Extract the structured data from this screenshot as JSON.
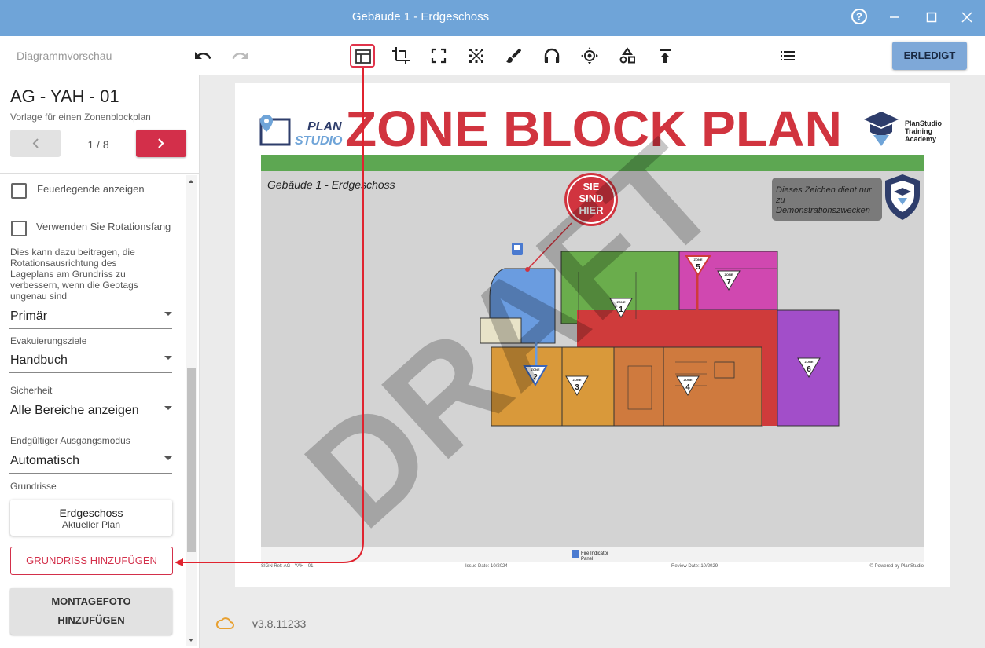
{
  "window": {
    "title": "Gebäude 1 - Erdgeschoss"
  },
  "toolbar": {
    "preview_label": "Diagrammvorschau",
    "done_label": "ERLEDIGT"
  },
  "sidebar": {
    "plan_title": "AG - YAH - 01",
    "plan_subtitle": "Vorlage für einen Zonenblockplan",
    "pager": "1 / 8",
    "fire_legend_label": "Feuerlegende anzeigen",
    "rotation_label": "Verwenden Sie Rotationsfang",
    "rotation_help": "Dies kann dazu beitragen, die Rotationsausrichtung des Lageplans am Grundriss zu verbessern, wenn die Geotags ungenau sind",
    "primary_value": "Primär",
    "evac_label": "Evakuierungsziele",
    "evac_value": "Handbuch",
    "security_label": "Sicherheit",
    "security_value": "Alle Bereiche anzeigen",
    "exit_label": "Endgültiger Ausgangsmodus",
    "exit_value": "Automatisch",
    "floorplans_label": "Grundrisse",
    "floor_name": "Erdgeschoss",
    "floor_current": "Aktueller Plan",
    "add_floorplan": "GRUNDRISS HINZUFÜGEN",
    "add_photo_line1": "MONTAGEFOTO",
    "add_photo_line2": "HINZUFÜGEN"
  },
  "main": {
    "version": "v3.8.11233"
  },
  "sheet": {
    "logo_plan": "PLAN",
    "logo_studio": "STUDIO",
    "title": "ZONE BLOCK PLAN",
    "academy": [
      "PlanStudio",
      "Training",
      "Academy"
    ],
    "building": "Gebäude 1 - Erdgeschoss",
    "demo_note": "Dieses Zeichen dient nur zu Demonstrationszwecken",
    "you_are_here": [
      "SIE",
      "SIND",
      "HIER"
    ],
    "watermark": "DRAFT",
    "fire_panel": [
      "Fire Indicator",
      "Panel"
    ],
    "footer_ref": "SIGN Ref: AG - YAH - 01",
    "footer_issue": "Issue Date: 10/2024",
    "footer_review": "Review Date: 10/2029",
    "footer_powered": "© Powered by PlanStudio",
    "zone_word": "ZONE",
    "zones": [
      "1",
      "2",
      "3",
      "4",
      "5",
      "6",
      "7"
    ]
  }
}
